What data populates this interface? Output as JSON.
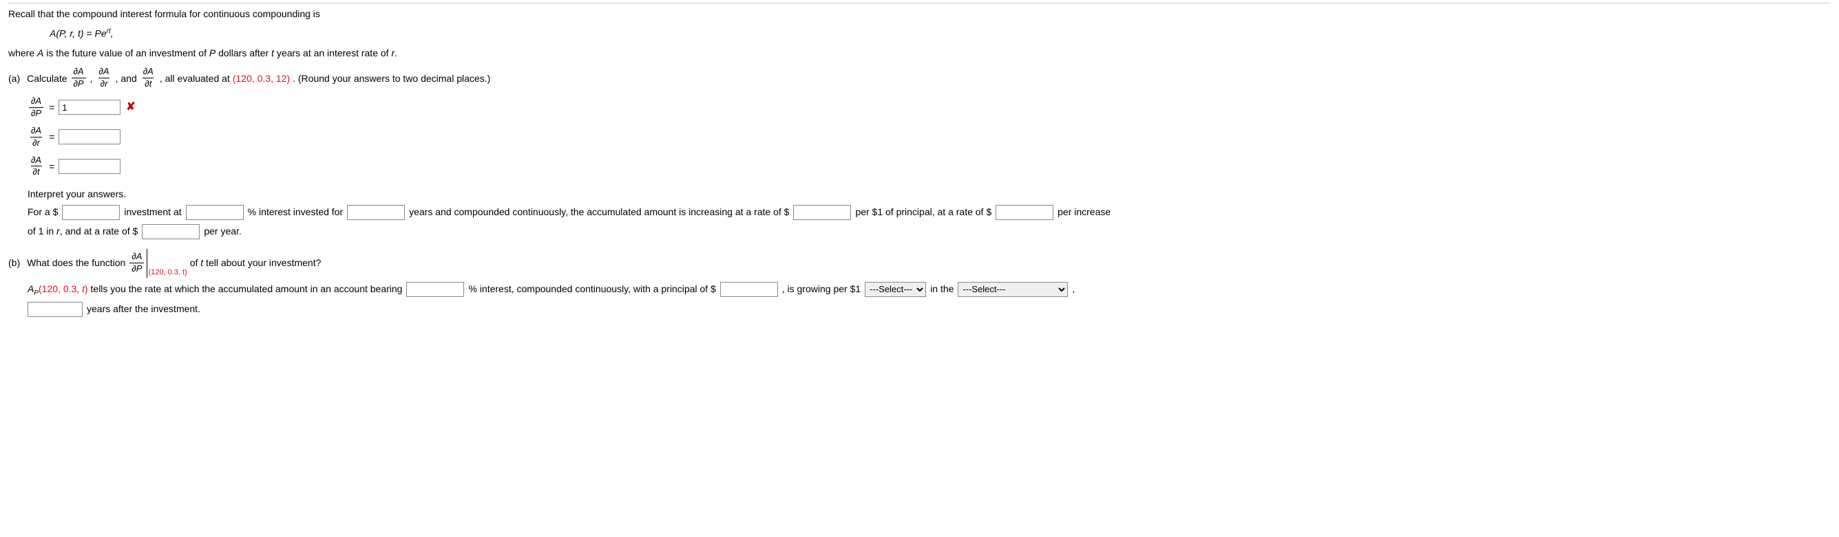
{
  "intro": {
    "line1": "Recall that the compound interest formula for continuous compounding is",
    "formula_lhs": "A(P, r, t) = Pe",
    "formula_exp": "rt",
    "formula_comma": ",",
    "line2_a": "where ",
    "line2_A": "A",
    "line2_b": " is the future value of an investment of ",
    "line2_P": "P",
    "line2_c": " dollars after ",
    "line2_t": "t",
    "line2_d": " years at an interest rate of ",
    "line2_r": "r",
    "line2_e": "."
  },
  "partA": {
    "label": "(a)",
    "calc": "Calculate",
    "and": ", and",
    "comma": ", ",
    "eval_a": ", all evaluated at ",
    "eval_pt": "(120, 0.3, 12)",
    "eval_b": ". (Round your answers to two decimal places.)",
    "dA": "∂A",
    "dP": "∂P",
    "dr": "∂r",
    "dt": "∂t",
    "eq": "=",
    "ans1_value": "1"
  },
  "interpret": {
    "head": "Interpret your answers.",
    "s1": "For a $",
    "s2": "investment at",
    "s3": "% interest invested for",
    "s4": "years and compounded continuously, the accumulated amount is increasing at a rate of $",
    "s5": "per $1 of principal, at a rate of $",
    "s6": "per increase",
    "s7": "of 1 in ",
    "s7r": "r",
    "s7b": ", and at a rate of $",
    "s8": "per year."
  },
  "partB": {
    "label": "(b)",
    "q1": "What does the function",
    "q2": "of ",
    "q2t": "t",
    "q2b": " tell about your investment?",
    "eval_sub": "(120, 0.3, t)",
    "dA": "∂A",
    "dP": "∂P",
    "line2_a": "A",
    "line2_sub": "P",
    "line2_arg": "(120, 0.3, ",
    "line2_argt": "t",
    "line2_argb": ")",
    "line2_b": " tells you the rate at which the accumulated amount in an account bearing",
    "line2_c": "% interest, compounded continuously, with a principal of $",
    "line2_d": ", is growing per $1",
    "line2_e": "in the",
    "line2_f": ",",
    "line3": "years after the investment.",
    "select_placeholder": "---Select---"
  }
}
